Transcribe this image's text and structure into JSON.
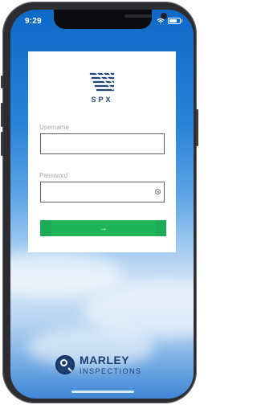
{
  "status_bar": {
    "time": "9:29"
  },
  "login": {
    "brand": "SPX",
    "username_label": "Username",
    "username_value": "",
    "password_label": "Password",
    "password_value": "",
    "submit_label": "→"
  },
  "footer": {
    "brand_word": "MARLEY",
    "brand_sub": "INSPECTIONS"
  },
  "colors": {
    "accent_green": "#1fb35a",
    "brand_navy": "#1f3e72",
    "sky_top": "#0e69c7"
  }
}
